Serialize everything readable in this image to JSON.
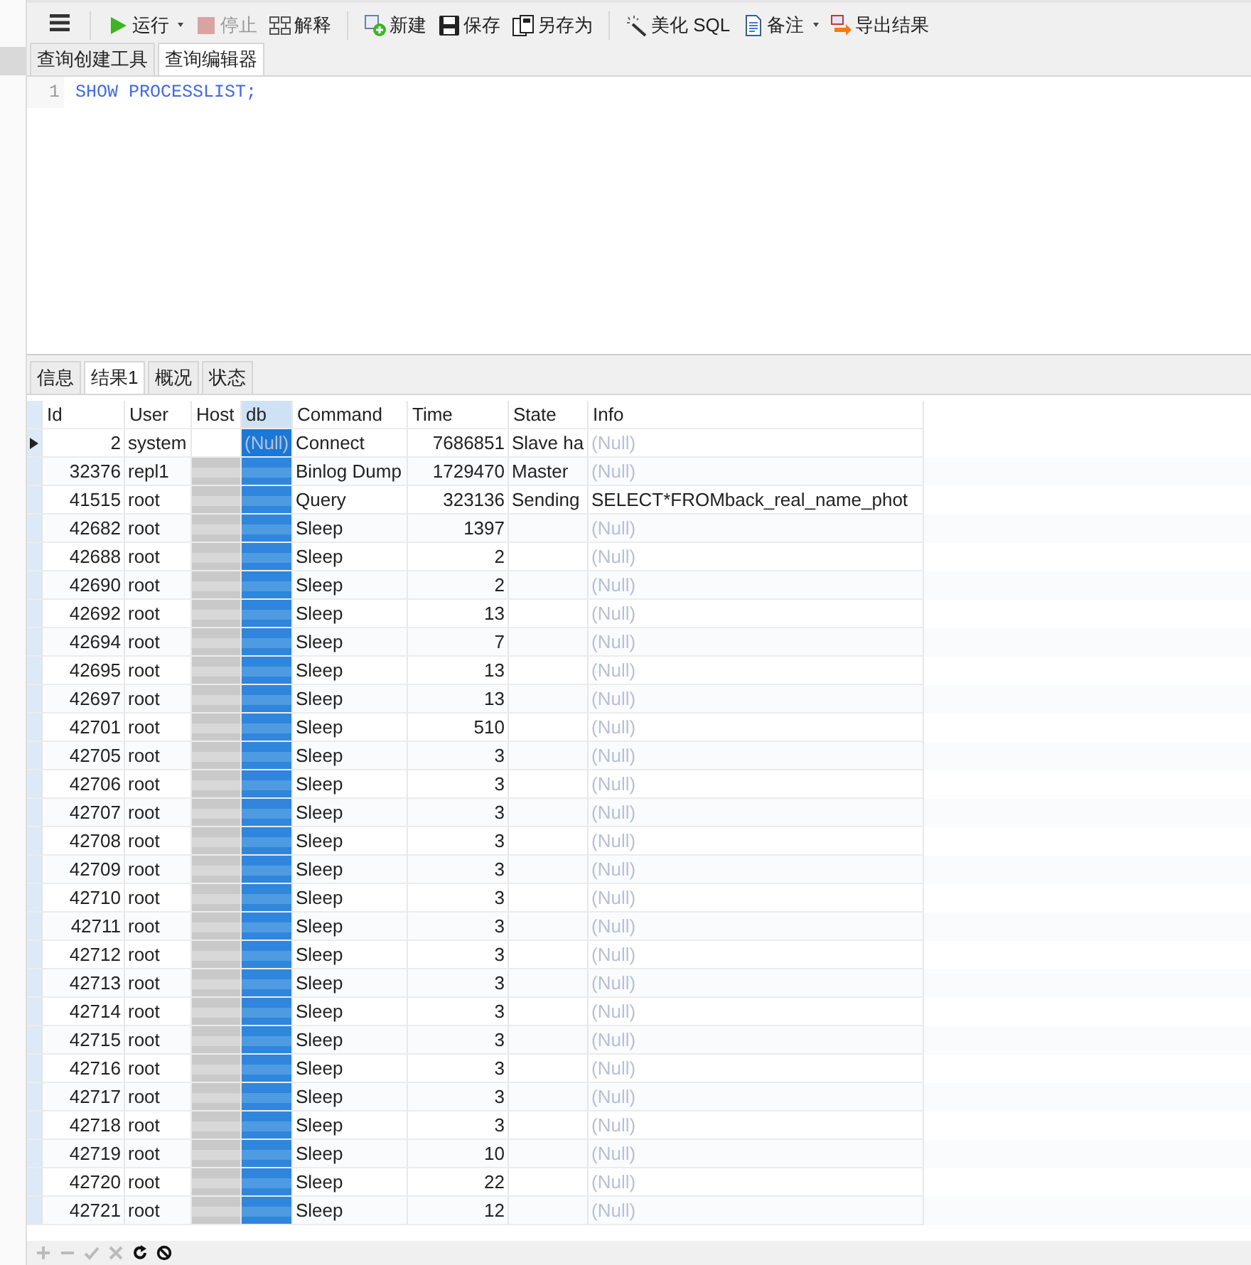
{
  "toolbar": {
    "items": [
      {
        "label": "运行",
        "disabled": false,
        "dropdown": true
      },
      {
        "label": "停止",
        "disabled": true,
        "dropdown": false
      },
      {
        "label": "解释",
        "disabled": false,
        "dropdown": false
      },
      {
        "label": "新建",
        "disabled": false,
        "dropdown": false
      },
      {
        "label": "保存",
        "disabled": false,
        "dropdown": false
      },
      {
        "label": "另存为",
        "disabled": false,
        "dropdown": false
      },
      {
        "label": "美化 SQL",
        "disabled": false,
        "dropdown": false
      },
      {
        "label": "备注",
        "disabled": false,
        "dropdown": true
      },
      {
        "label": "导出结果",
        "disabled": false,
        "dropdown": false
      }
    ]
  },
  "editor_tabs": [
    {
      "label": "查询创建工具",
      "selected": false
    },
    {
      "label": "查询编辑器",
      "selected": true
    }
  ],
  "editor": {
    "lines": [
      {
        "number": "1",
        "code": "SHOW PROCESSLIST;"
      }
    ]
  },
  "result_tabs": [
    {
      "label": "信息",
      "selected": false
    },
    {
      "label": "结果1",
      "selected": true
    },
    {
      "label": "概况",
      "selected": false
    },
    {
      "label": "状态",
      "selected": false
    }
  ],
  "table": {
    "columns": [
      {
        "label": "Id",
        "selected": false
      },
      {
        "label": "User",
        "selected": false
      },
      {
        "label": "Host",
        "selected": false
      },
      {
        "label": "db",
        "selected": true
      },
      {
        "label": "Command",
        "selected": false
      },
      {
        "label": "Time",
        "selected": false
      },
      {
        "label": "State",
        "selected": false
      },
      {
        "label": "Info",
        "selected": false
      }
    ],
    "rows": [
      {
        "id": "2",
        "user": "system",
        "db": "(Null)",
        "command": "Connect",
        "time": "7686851",
        "state": "Slave ha",
        "info": "(Null)",
        "current": true,
        "redacted": false,
        "db_null": true,
        "info_null": true
      },
      {
        "id": "32376",
        "user": "repl1",
        "command": "Binlog Dump",
        "time": "1729470",
        "state": "Master",
        "info": "(Null)",
        "current": false,
        "redacted": true,
        "info_null": true
      },
      {
        "id": "41515",
        "user": "root",
        "command": "Query",
        "time": "323136",
        "state": "Sending",
        "info": "SELECT*FROMback_real_name_phot",
        "current": false,
        "redacted": true,
        "info_null": false
      },
      {
        "id": "42682",
        "user": "root",
        "command": "Sleep",
        "time": "1397",
        "info": "(Null)",
        "current": false,
        "redacted": true,
        "info_null": true
      },
      {
        "id": "42688",
        "user": "root",
        "command": "Sleep",
        "time": "2",
        "info": "(Null)",
        "current": false,
        "redacted": true,
        "info_null": true
      },
      {
        "id": "42690",
        "user": "root",
        "command": "Sleep",
        "time": "2",
        "info": "(Null)",
        "current": false,
        "redacted": true,
        "info_null": true
      },
      {
        "id": "42692",
        "user": "root",
        "command": "Sleep",
        "time": "13",
        "info": "(Null)",
        "current": false,
        "redacted": true,
        "info_null": true
      },
      {
        "id": "42694",
        "user": "root",
        "command": "Sleep",
        "time": "7",
        "info": "(Null)",
        "current": false,
        "redacted": true,
        "info_null": true
      },
      {
        "id": "42695",
        "user": "root",
        "command": "Sleep",
        "time": "13",
        "info": "(Null)",
        "current": false,
        "redacted": true,
        "info_null": true
      },
      {
        "id": "42697",
        "user": "root",
        "command": "Sleep",
        "time": "13",
        "info": "(Null)",
        "current": false,
        "redacted": true,
        "info_null": true
      },
      {
        "id": "42701",
        "user": "root",
        "command": "Sleep",
        "time": "510",
        "info": "(Null)",
        "current": false,
        "redacted": true,
        "info_null": true
      },
      {
        "id": "42705",
        "user": "root",
        "command": "Sleep",
        "time": "3",
        "info": "(Null)",
        "current": false,
        "redacted": true,
        "info_null": true
      },
      {
        "id": "42706",
        "user": "root",
        "command": "Sleep",
        "time": "3",
        "info": "(Null)",
        "current": false,
        "redacted": true,
        "info_null": true
      },
      {
        "id": "42707",
        "user": "root",
        "command": "Sleep",
        "time": "3",
        "info": "(Null)",
        "current": false,
        "redacted": true,
        "info_null": true
      },
      {
        "id": "42708",
        "user": "root",
        "command": "Sleep",
        "time": "3",
        "info": "(Null)",
        "current": false,
        "redacted": true,
        "info_null": true
      },
      {
        "id": "42709",
        "user": "root",
        "command": "Sleep",
        "time": "3",
        "info": "(Null)",
        "current": false,
        "redacted": true,
        "info_null": true
      },
      {
        "id": "42710",
        "user": "root",
        "command": "Sleep",
        "time": "3",
        "info": "(Null)",
        "current": false,
        "redacted": true,
        "info_null": true
      },
      {
        "id": "42711",
        "user": "root",
        "command": "Sleep",
        "time": "3",
        "info": "(Null)",
        "current": false,
        "redacted": true,
        "info_null": true
      },
      {
        "id": "42712",
        "user": "root",
        "command": "Sleep",
        "time": "3",
        "info": "(Null)",
        "current": false,
        "redacted": true,
        "info_null": true
      },
      {
        "id": "42713",
        "user": "root",
        "command": "Sleep",
        "time": "3",
        "info": "(Null)",
        "current": false,
        "redacted": true,
        "info_null": true
      },
      {
        "id": "42714",
        "user": "root",
        "command": "Sleep",
        "time": "3",
        "info": "(Null)",
        "current": false,
        "redacted": true,
        "info_null": true
      },
      {
        "id": "42715",
        "user": "root",
        "command": "Sleep",
        "time": "3",
        "info": "(Null)",
        "current": false,
        "redacted": true,
        "info_null": true
      },
      {
        "id": "42716",
        "user": "root",
        "command": "Sleep",
        "time": "3",
        "info": "(Null)",
        "current": false,
        "redacted": true,
        "info_null": true
      },
      {
        "id": "42717",
        "user": "root",
        "command": "Sleep",
        "time": "3",
        "info": "(Null)",
        "current": false,
        "redacted": true,
        "info_null": true
      },
      {
        "id": "42718",
        "user": "root",
        "command": "Sleep",
        "time": "3",
        "info": "(Null)",
        "current": false,
        "redacted": true,
        "info_null": true
      },
      {
        "id": "42719",
        "user": "root",
        "command": "Sleep",
        "time": "10",
        "info": "(Null)",
        "current": false,
        "redacted": true,
        "info_null": true
      },
      {
        "id": "42720",
        "user": "root",
        "command": "Sleep",
        "time": "22",
        "info": "(Null)",
        "current": false,
        "redacted": true,
        "info_null": true
      },
      {
        "id": "42721",
        "user": "root",
        "command": "Sleep",
        "time": "12",
        "info": "(Null)",
        "current": false,
        "redacted": true,
        "info_null": true
      }
    ]
  },
  "bottom_bar": {
    "buttons": [
      {
        "disabled": true
      },
      {
        "disabled": true
      },
      {
        "disabled": true
      },
      {
        "disabled": true
      },
      {
        "disabled": false
      },
      {
        "disabled": false
      }
    ]
  }
}
